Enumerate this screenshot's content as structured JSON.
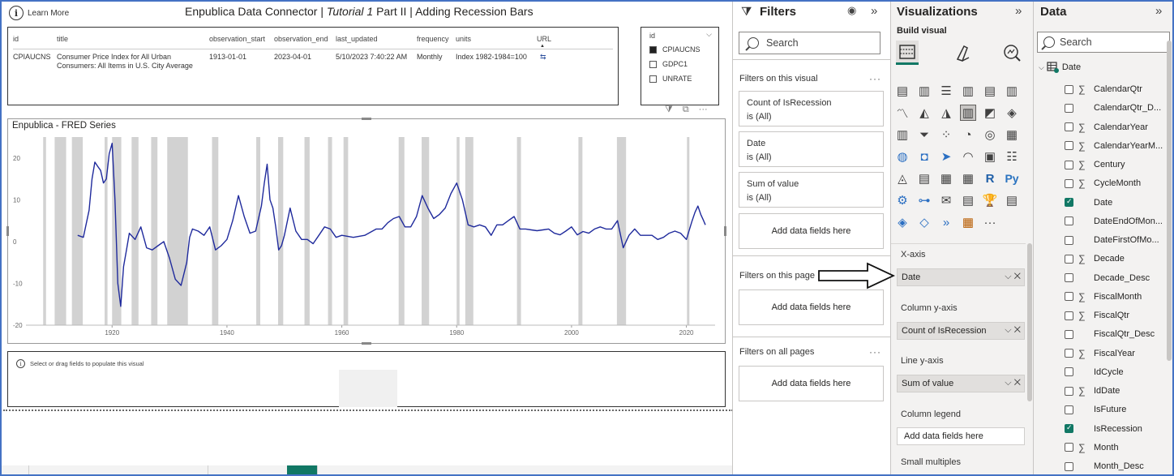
{
  "report": {
    "learn_more": "Learn More",
    "title_prefix": "Enpublica Data Connector | ",
    "title_italic": "Tutorial 1",
    "title_suffix": "  Part II | Adding Recession Bars",
    "table": {
      "columns": [
        "id",
        "title",
        "observation_start",
        "observation_end",
        "last_updated",
        "frequency",
        "units",
        "URL"
      ],
      "row": {
        "id": "CPIAUCNS",
        "title_line1": "Consumer Price Index for All Urban",
        "title_line2": "Consumers: All Items in U.S. City Average",
        "observation_start": "1913-01-01",
        "observation_end": "2023-04-01",
        "last_updated": "5/10/2023 7:40:22 AM",
        "frequency": "Monthly",
        "units": "Index 1982-1984=100"
      }
    },
    "slicer": {
      "header": "id",
      "options": [
        {
          "label": "CPIAUCNS",
          "checked": true
        },
        {
          "label": "GDPC1",
          "checked": false
        },
        {
          "label": "UNRATE",
          "checked": false
        }
      ]
    },
    "empty_visual_message": "Select or drag fields to populate this visual"
  },
  "chart_data": {
    "type": "line",
    "title": "Enpublica - FRED Series",
    "xlim": [
      1905,
      2025
    ],
    "ylim": [
      -20,
      25
    ],
    "x_ticks": [
      "1920",
      "1940",
      "1960",
      "1980",
      "2000",
      "2020"
    ],
    "y_ticks": [
      "20",
      "10",
      "0",
      "-10",
      "-20"
    ],
    "line_color": "#1f2a9c",
    "bar_color": "#d2d2d2",
    "recession_bars": [
      {
        "start": 1908.0,
        "end": 1908.5
      },
      {
        "start": 1910.0,
        "end": 1912.0
      },
      {
        "start": 1913.0,
        "end": 1914.9
      },
      {
        "start": 1918.7,
        "end": 1919.2
      },
      {
        "start": 1920.0,
        "end": 1921.6
      },
      {
        "start": 1923.4,
        "end": 1924.6
      },
      {
        "start": 1926.8,
        "end": 1927.9
      },
      {
        "start": 1929.6,
        "end": 1933.2
      },
      {
        "start": 1937.4,
        "end": 1938.5
      },
      {
        "start": 1945.1,
        "end": 1945.8
      },
      {
        "start": 1948.9,
        "end": 1949.8
      },
      {
        "start": 1953.5,
        "end": 1954.4
      },
      {
        "start": 1957.6,
        "end": 1958.3
      },
      {
        "start": 1960.3,
        "end": 1961.1
      },
      {
        "start": 1969.9,
        "end": 1970.9
      },
      {
        "start": 1973.9,
        "end": 1975.2
      },
      {
        "start": 1980.0,
        "end": 1980.5
      },
      {
        "start": 1981.5,
        "end": 1982.9
      },
      {
        "start": 1990.5,
        "end": 1991.2
      },
      {
        "start": 2001.2,
        "end": 2001.9
      },
      {
        "start": 2007.9,
        "end": 2009.5
      },
      {
        "start": 2020.1,
        "end": 2020.3
      }
    ],
    "series": [
      {
        "x": [
          1914.0,
          1915.0,
          1916.0,
          1916.5,
          1917.0,
          1917.5,
          1918.0,
          1918.5,
          1919.0,
          1919.5,
          1920.0,
          1920.5,
          1921.0,
          1921.5,
          1922.0,
          1922.5,
          1923.0,
          1924.0,
          1925.0,
          1926.0,
          1927.0,
          1928.0,
          1929.0,
          1930.0,
          1931.0,
          1932.0,
          1933.0,
          1933.5,
          1934.0,
          1935.0,
          1936.0,
          1937.0,
          1938.0,
          1939.0,
          1940.0,
          1941.0,
          1942.0,
          1943.0,
          1944.0,
          1945.0,
          1946.0,
          1946.5,
          1947.0,
          1947.5,
          1948.0,
          1948.5,
          1949.0,
          1949.5,
          1950.0,
          1951.0,
          1952.0,
          1953.0,
          1954.0,
          1955.0,
          1956.0,
          1957.0,
          1958.0,
          1959.0,
          1960.0,
          1962.0,
          1964.0,
          1966.0,
          1967.0,
          1968.0,
          1969.0,
          1970.0,
          1971.0,
          1972.0,
          1973.0,
          1974.0,
          1975.0,
          1976.0,
          1977.0,
          1978.0,
          1979.0,
          1980.0,
          1980.5,
          1981.0,
          1982.0,
          1983.0,
          1984.0,
          1985.0,
          1986.0,
          1987.0,
          1988.0,
          1989.0,
          1990.0,
          1991.0,
          1992.0,
          1993.0,
          1994.0,
          1995.0,
          1996.0,
          1997.0,
          1998.0,
          1999.0,
          2000.0,
          2001.0,
          2002.0,
          2003.0,
          2004.0,
          2005.0,
          2006.0,
          2007.0,
          2008.0,
          2009.0,
          2010.0,
          2011.0,
          2012.0,
          2013.0,
          2014.0,
          2015.0,
          2016.0,
          2017.0,
          2018.0,
          2019.0,
          2020.0,
          2021.0,
          2021.5,
          2022.0,
          2022.5,
          2023.0,
          2023.3
        ],
        "y": [
          1.5,
          1.0,
          7.5,
          15.0,
          19.0,
          18.0,
          17.0,
          14.0,
          15.0,
          21.0,
          23.5,
          10.0,
          -10.0,
          -15.5,
          -6.0,
          -2.0,
          2.0,
          0.5,
          3.5,
          -1.5,
          -2.0,
          -1.0,
          0.0,
          -4.0,
          -9.0,
          -10.5,
          -5.0,
          1.0,
          3.0,
          2.5,
          1.5,
          3.5,
          -2.0,
          -1.0,
          0.5,
          5.0,
          11.0,
          6.0,
          2.0,
          2.5,
          8.5,
          14.0,
          18.5,
          10.0,
          8.0,
          3.5,
          -2.0,
          -1.0,
          1.5,
          8.0,
          2.5,
          0.5,
          0.5,
          -0.5,
          1.5,
          3.5,
          3.0,
          1.0,
          1.5,
          1.0,
          1.5,
          3.0,
          3.0,
          4.5,
          5.5,
          6.0,
          3.5,
          3.5,
          6.0,
          11.0,
          8.0,
          5.5,
          6.5,
          8.0,
          11.5,
          14.0,
          12.0,
          10.0,
          4.0,
          3.5,
          4.0,
          3.5,
          1.5,
          4.0,
          4.0,
          5.0,
          6.0,
          3.0,
          3.0,
          2.8,
          2.6,
          2.8,
          3.0,
          2.0,
          1.6,
          2.5,
          3.5,
          1.6,
          2.4,
          2.0,
          3.0,
          3.5,
          3.0,
          3.0,
          5.0,
          -1.5,
          1.5,
          3.0,
          1.5,
          1.5,
          1.5,
          0.5,
          1.0,
          2.0,
          2.5,
          2.0,
          0.5,
          5.0,
          7.0,
          8.5,
          6.5,
          5.0,
          4.0
        ]
      }
    ]
  },
  "filters": {
    "title": "Filters",
    "search_placeholder": "Search",
    "on_visual_label": "Filters on this visual",
    "cards": [
      {
        "name": "Count of IsRecession",
        "state": "is (All)"
      },
      {
        "name": "Date",
        "state": "is (All)"
      },
      {
        "name": "Sum of value",
        "state": "is (All)"
      }
    ],
    "add_fields": "Add data fields here",
    "on_page_label": "Filters on this page",
    "on_all_label": "Filters on all pages",
    "more": "···"
  },
  "visualizations": {
    "title": "Visualizations",
    "build_visual": "Build visual",
    "wells": [
      {
        "label": "X-axis",
        "value": "Date"
      },
      {
        "label": "Column y-axis",
        "value": "Count of IsRecession"
      },
      {
        "label": "Line y-axis",
        "value": "Sum of value"
      }
    ],
    "column_legend_label": "Column legend",
    "column_legend_add": "Add data fields here",
    "small_multiples_label": "Small multiples",
    "r_label": "R",
    "py_label": "Py",
    "more": "···"
  },
  "data": {
    "title": "Data",
    "search_placeholder": "Search",
    "table_name": "Date",
    "fields": [
      {
        "name": "CalendarQtr",
        "sigma": true,
        "checked": false
      },
      {
        "name": "CalendarQtr_D...",
        "sigma": false,
        "checked": false
      },
      {
        "name": "CalendarYear",
        "sigma": true,
        "checked": false
      },
      {
        "name": "CalendarYearM...",
        "sigma": true,
        "checked": false
      },
      {
        "name": "Century",
        "sigma": true,
        "checked": false
      },
      {
        "name": "CycleMonth",
        "sigma": true,
        "checked": false
      },
      {
        "name": "Date",
        "sigma": false,
        "checked": true
      },
      {
        "name": "DateEndOfMon...",
        "sigma": false,
        "checked": false
      },
      {
        "name": "DateFirstOfMo...",
        "sigma": false,
        "checked": false
      },
      {
        "name": "Decade",
        "sigma": true,
        "checked": false
      },
      {
        "name": "Decade_Desc",
        "sigma": false,
        "checked": false
      },
      {
        "name": "FiscalMonth",
        "sigma": true,
        "checked": false
      },
      {
        "name": "FiscalQtr",
        "sigma": true,
        "checked": false
      },
      {
        "name": "FiscalQtr_Desc",
        "sigma": false,
        "checked": false
      },
      {
        "name": "FiscalYear",
        "sigma": true,
        "checked": false
      },
      {
        "name": "IdCycle",
        "sigma": false,
        "checked": false
      },
      {
        "name": "IdDate",
        "sigma": true,
        "checked": false
      },
      {
        "name": "IsFuture",
        "sigma": false,
        "checked": false
      },
      {
        "name": "IsRecession",
        "sigma": false,
        "checked": true
      },
      {
        "name": "Month",
        "sigma": true,
        "checked": false
      },
      {
        "name": "Month_Desc",
        "sigma": false,
        "checked": false
      }
    ]
  },
  "colors": {
    "accent": "#117865",
    "pane_border": "#c8c6c4",
    "frame": "#4472c4"
  }
}
